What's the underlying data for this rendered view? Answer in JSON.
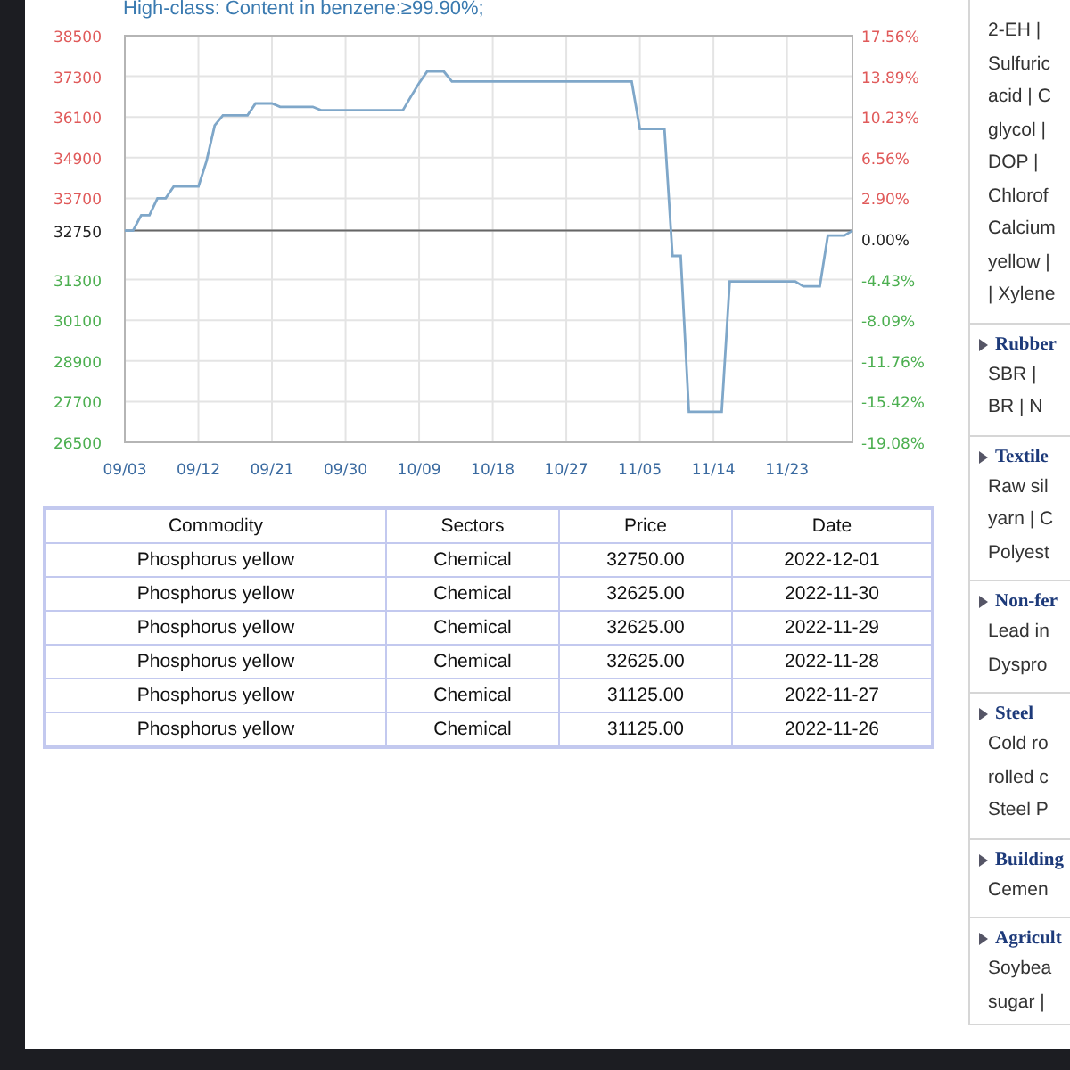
{
  "chart_title": "High-class: Content in benzene:≥99.90%;",
  "chart": {
    "chart_data": {
      "type": "line",
      "ylim": [
        26500,
        38500
      ],
      "categories": [
        "09/03",
        null,
        null,
        null,
        null,
        null,
        null,
        null,
        null,
        "09/12",
        null,
        null,
        null,
        null,
        null,
        null,
        null,
        null,
        "09/21",
        null,
        null,
        null,
        null,
        null,
        null,
        null,
        null,
        "09/30",
        null,
        null,
        null,
        null,
        null,
        null,
        null,
        null,
        "10/09",
        null,
        null,
        null,
        null,
        null,
        null,
        null,
        null,
        "10/18",
        null,
        null,
        null,
        null,
        null,
        null,
        null,
        null,
        "10/27",
        null,
        null,
        null,
        null,
        null,
        null,
        null,
        null,
        "11/05",
        null,
        null,
        null,
        null,
        null,
        null,
        null,
        null,
        "11/14",
        null,
        null,
        null,
        null,
        null,
        null,
        null,
        null,
        "11/23",
        null,
        null,
        null,
        null,
        null,
        null,
        null,
        null
      ],
      "yticks": [
        38500,
        37300,
        36100,
        34900,
        33700,
        32750,
        31300,
        30100,
        28900,
        27700,
        26500
      ],
      "series": [
        {
          "color": "#7fa7c9",
          "values": [
            32750,
            32750,
            33200,
            33200,
            33700,
            33700,
            34050,
            34050,
            34050,
            34050,
            34800,
            35850,
            36150,
            36150,
            36150,
            36150,
            36500,
            36500,
            36500,
            36400,
            36400,
            36400,
            36400,
            36400,
            36300,
            36300,
            36300,
            36300,
            36300,
            36300,
            36300,
            36300,
            36300,
            36300,
            36300,
            36700,
            37100,
            37450,
            37450,
            37450,
            37150,
            37150,
            37150,
            37150,
            37150,
            37150,
            37150,
            37150,
            37150,
            37150,
            37150,
            37150,
            37150,
            37150,
            37150,
            37150,
            37150,
            37150,
            37150,
            37150,
            37150,
            37150,
            37150,
            35750,
            35750,
            35750,
            35750,
            32000,
            32000,
            27400,
            27400,
            27400,
            27400,
            27400,
            31250,
            31250,
            31250,
            31250,
            31250,
            31250,
            31250,
            31250,
            31250,
            31100,
            31100,
            31100,
            32600,
            32600,
            32600,
            32750
          ]
        }
      ],
      "ref_lines": [
        {
          "axis": "y",
          "value": 32750
        }
      ],
      "grid": true
    },
    "right_axis": [
      {
        "label": "17.56%",
        "kind": "up"
      },
      {
        "label": "13.89%",
        "kind": "up"
      },
      {
        "label": "10.23%",
        "kind": "up"
      },
      {
        "label": "6.56%",
        "kind": "up"
      },
      {
        "label": "2.90%",
        "kind": "up"
      },
      {
        "label": "0.00%",
        "kind": "flat"
      },
      {
        "label": "-4.43%",
        "kind": "down"
      },
      {
        "label": "-8.09%",
        "kind": "down"
      },
      {
        "label": "-11.76%",
        "kind": "down"
      },
      {
        "label": "-15.42%",
        "kind": "down"
      },
      {
        "label": "-19.08%",
        "kind": "down"
      }
    ]
  },
  "table": {
    "columns": [
      "Commodity",
      "Sectors",
      "Price",
      "Date"
    ],
    "rows": [
      [
        "Phosphorus yellow",
        "Chemical",
        "32750.00",
        "2022-12-01"
      ],
      [
        "Phosphorus yellow",
        "Chemical",
        "32625.00",
        "2022-11-30"
      ],
      [
        "Phosphorus yellow",
        "Chemical",
        "32625.00",
        "2022-11-29"
      ],
      [
        "Phosphorus yellow",
        "Chemical",
        "32625.00",
        "2022-11-28"
      ],
      [
        "Phosphorus yellow",
        "Chemical",
        "31125.00",
        "2022-11-27"
      ],
      [
        "Phosphorus yellow",
        "Chemical",
        "31125.00",
        "2022-11-26"
      ]
    ]
  },
  "sidebar": {
    "sections": [
      {
        "items": [
          "2-EH |",
          "Sulfuric",
          "acid | C",
          "glycol |",
          "DOP |",
          "Chlorof",
          "Calcium",
          "yellow |",
          "| Xylene"
        ]
      },
      {
        "heading": "Rubber",
        "items": [
          "SBR |",
          "BR | N"
        ]
      },
      {
        "heading": "Textile",
        "items": [
          "Raw sil",
          "yarn | C",
          "Polyest"
        ]
      },
      {
        "heading": "Non-fer",
        "items": [
          "Lead in",
          "Dyspro"
        ]
      },
      {
        "heading": "Steel",
        "items": [
          "Cold ro",
          "rolled c",
          "Steel P"
        ]
      },
      {
        "heading": "Building",
        "items": [
          "Cemen"
        ]
      },
      {
        "heading": "Agricult",
        "items": [
          "Soybea",
          "sugar |"
        ]
      }
    ]
  }
}
